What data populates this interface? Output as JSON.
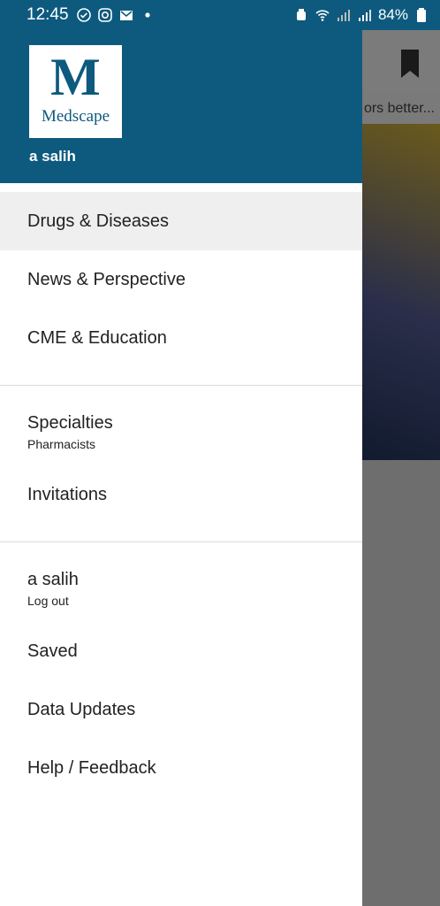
{
  "status_bar": {
    "time": "12:45",
    "battery_percent": "84%",
    "icons_left": [
      "check-circle-icon",
      "instagram-icon",
      "mail-icon",
      "dot-icon"
    ],
    "icons_right": [
      "alarm-icon",
      "wifi-icon",
      "signal-icon",
      "signal-icon",
      "battery-icon"
    ]
  },
  "background": {
    "headline_fragment": "ors better..."
  },
  "drawer": {
    "logo_letter": "M",
    "logo_brand": "Medscape",
    "user_name": "a salih",
    "sections": [
      {
        "items": [
          {
            "label": "Drugs & Diseases",
            "active": true
          },
          {
            "label": "News & Perspective"
          },
          {
            "label": "CME & Education"
          }
        ]
      },
      {
        "items": [
          {
            "label": "Specialties",
            "sub": "Pharmacists"
          },
          {
            "label": "Invitations"
          }
        ]
      },
      {
        "items": [
          {
            "label": "a salih",
            "sub": "Log out"
          },
          {
            "label": "Saved"
          },
          {
            "label": "Data Updates"
          },
          {
            "label": "Help / Feedback"
          }
        ]
      }
    ]
  },
  "colors": {
    "brand": "#0d5a7e",
    "active_row": "#efefef",
    "text": "#222222",
    "scrim": "#6e6e6e"
  }
}
